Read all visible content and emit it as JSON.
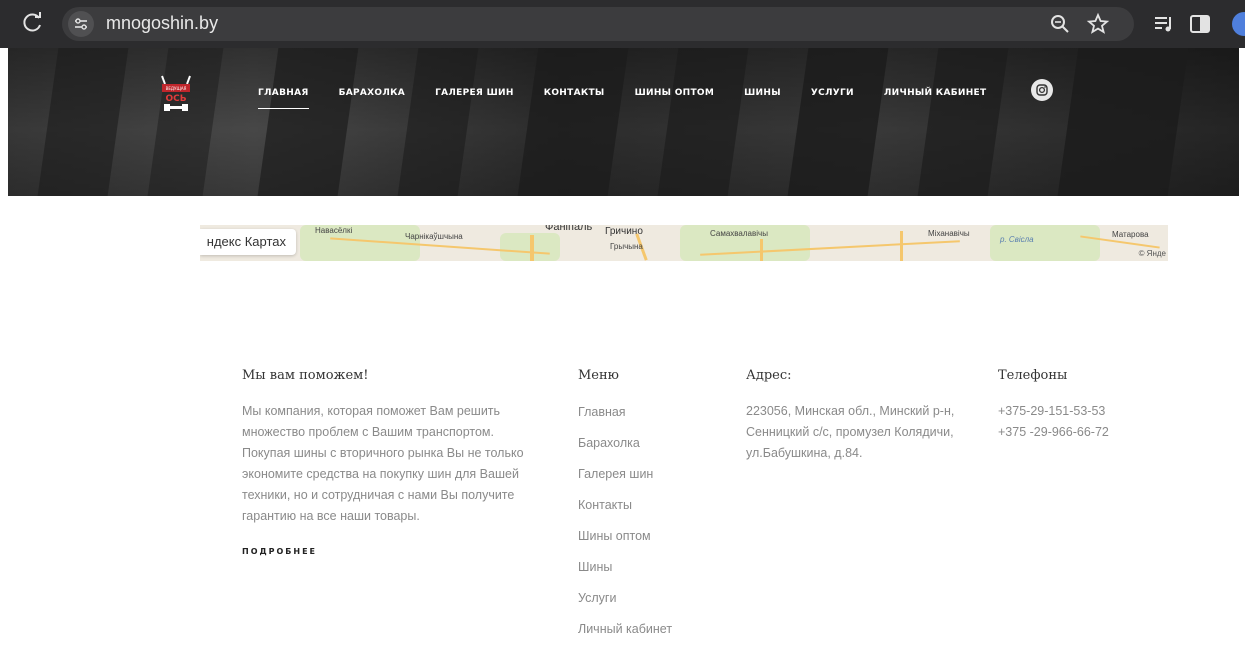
{
  "browser": {
    "url": "mnogoshin.by",
    "icons": [
      "reload-icon",
      "site-info-icon",
      "zoom-icon",
      "bookmark-star-icon",
      "media-control-icon",
      "side-panel-icon",
      "profile-avatar"
    ]
  },
  "header": {
    "logo_text_top": "ВЕДУЩАЯ",
    "logo_text_main": "ОСЬ",
    "nav": [
      {
        "label": "ГЛАВНАЯ",
        "active": true
      },
      {
        "label": "БАРАХОЛКА"
      },
      {
        "label": "ГАЛЕРЕЯ ШИН"
      },
      {
        "label": "КОНТАКТЫ"
      },
      {
        "label": "ШИНЫ ОПТОМ"
      },
      {
        "label": "ШИНЫ"
      },
      {
        "label": "УСЛУГИ"
      },
      {
        "label": "ЛИЧНЫЙ КАБИНЕТ"
      }
    ],
    "social_icon": "instagram-icon"
  },
  "map": {
    "button_label": "ндекс Картах",
    "labels": [
      "Навасёлкі",
      "Чарнікаўшчына",
      "Фаніпаль",
      "Гричино",
      "Грычына",
      "Самахвалавічы",
      "Міханавічы",
      "р. Свісла",
      "Матарова",
      "© Янде"
    ]
  },
  "footer": {
    "about": {
      "title": "Мы вам поможем!",
      "text": "Мы компания, которая поможет Вам решить множество проблем с Вашим транспортом. Покупая шины с вторичного рынка Вы не только экономите средства на покупку шин для Вашей техники, но и сотрудничая с нами Вы получите гарантию на все наши товары.",
      "more": "ПОДРОБНЕЕ"
    },
    "menu": {
      "title": "Меню",
      "items": [
        "Главная",
        "Барахолка",
        "Галерея шин",
        "Контакты",
        "Шины оптом",
        "Шины",
        "Услуги",
        "Личный кабинет"
      ]
    },
    "address": {
      "title": "Адрес:",
      "text": "223056, Минская обл., Минский р-н, Сенницкий с/с, промузел Колядичи, ул.Бабушкина, д.84."
    },
    "phones": {
      "title": "Телефоны",
      "items": [
        "+375-29-151-53-53",
        "+375 -29-966-66-72"
      ]
    }
  }
}
